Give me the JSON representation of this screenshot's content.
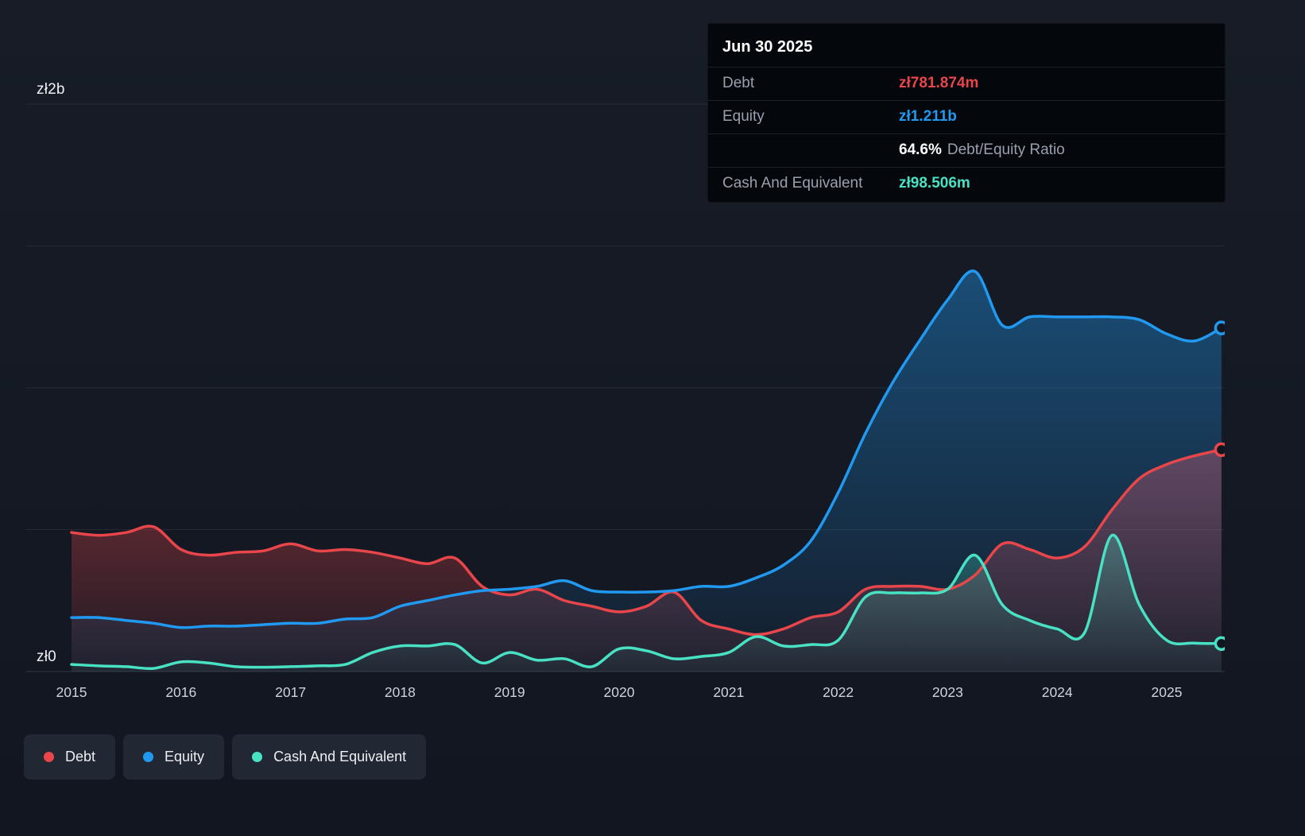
{
  "tooltip": {
    "date": "Jun 30 2025",
    "debt_label": "Debt",
    "debt_value": "zł781.874m",
    "equity_label": "Equity",
    "equity_value": "zł1.211b",
    "ratio_value": "64.6%",
    "ratio_label": "Debt/Equity Ratio",
    "cash_label": "Cash And Equivalent",
    "cash_value": "zł98.506m"
  },
  "chart_data": {
    "type": "area",
    "currency": "zł",
    "unit": "billions PLN",
    "grid": true,
    "legend_position": "bottom-left",
    "ylim": [
      0,
      2
    ],
    "y_tick_labels": [
      "zł0",
      "zł2b"
    ],
    "x_ticks": [
      "2015",
      "2016",
      "2017",
      "2018",
      "2019",
      "2020",
      "2021",
      "2022",
      "2023",
      "2024",
      "2025"
    ],
    "x": [
      2015.0,
      2015.25,
      2015.5,
      2015.75,
      2016.0,
      2016.25,
      2016.5,
      2016.75,
      2017.0,
      2017.25,
      2017.5,
      2017.75,
      2018.0,
      2018.25,
      2018.5,
      2018.75,
      2019.0,
      2019.25,
      2019.5,
      2019.75,
      2020.0,
      2020.25,
      2020.5,
      2020.75,
      2021.0,
      2021.25,
      2021.5,
      2021.75,
      2022.0,
      2022.25,
      2022.5,
      2022.75,
      2023.0,
      2023.25,
      2023.5,
      2023.75,
      2024.0,
      2024.25,
      2024.5,
      2024.75,
      2025.0,
      2025.25,
      2025.5
    ],
    "series": [
      {
        "name": "Debt",
        "color": "#e8464a",
        "values": [
          0.49,
          0.48,
          0.49,
          0.51,
          0.43,
          0.41,
          0.42,
          0.425,
          0.45,
          0.425,
          0.43,
          0.42,
          0.4,
          0.38,
          0.4,
          0.3,
          0.27,
          0.29,
          0.25,
          0.23,
          0.21,
          0.23,
          0.28,
          0.18,
          0.15,
          0.13,
          0.15,
          0.19,
          0.21,
          0.29,
          0.3,
          0.3,
          0.29,
          0.34,
          0.45,
          0.43,
          0.4,
          0.44,
          0.57,
          0.68,
          0.73,
          0.76,
          0.782
        ]
      },
      {
        "name": "Equity",
        "color": "#2199f1",
        "values": [
          0.19,
          0.19,
          0.18,
          0.17,
          0.155,
          0.16,
          0.16,
          0.165,
          0.17,
          0.17,
          0.185,
          0.19,
          0.23,
          0.25,
          0.27,
          0.285,
          0.29,
          0.3,
          0.32,
          0.285,
          0.28,
          0.28,
          0.285,
          0.3,
          0.3,
          0.33,
          0.375,
          0.46,
          0.63,
          0.84,
          1.02,
          1.17,
          1.31,
          1.41,
          1.22,
          1.25,
          1.25,
          1.25,
          1.25,
          1.24,
          1.19,
          1.165,
          1.211
        ]
      },
      {
        "name": "Cash And Equivalent",
        "color": "#49e1c4",
        "values": [
          0.025,
          0.02,
          0.017,
          0.011,
          0.034,
          0.03,
          0.017,
          0.015,
          0.017,
          0.02,
          0.025,
          0.067,
          0.09,
          0.09,
          0.095,
          0.03,
          0.067,
          0.04,
          0.045,
          0.017,
          0.08,
          0.073,
          0.045,
          0.053,
          0.067,
          0.123,
          0.09,
          0.095,
          0.11,
          0.263,
          0.277,
          0.277,
          0.29,
          0.41,
          0.235,
          0.18,
          0.15,
          0.137,
          0.48,
          0.235,
          0.11,
          0.1,
          0.0985
        ]
      }
    ],
    "last_point": {
      "date": "Jun 30 2025",
      "debt": "781.874m",
      "equity": "1.211b",
      "debt_equity_ratio": "64.6%",
      "cash_and_equivalent": "98.506m"
    }
  }
}
